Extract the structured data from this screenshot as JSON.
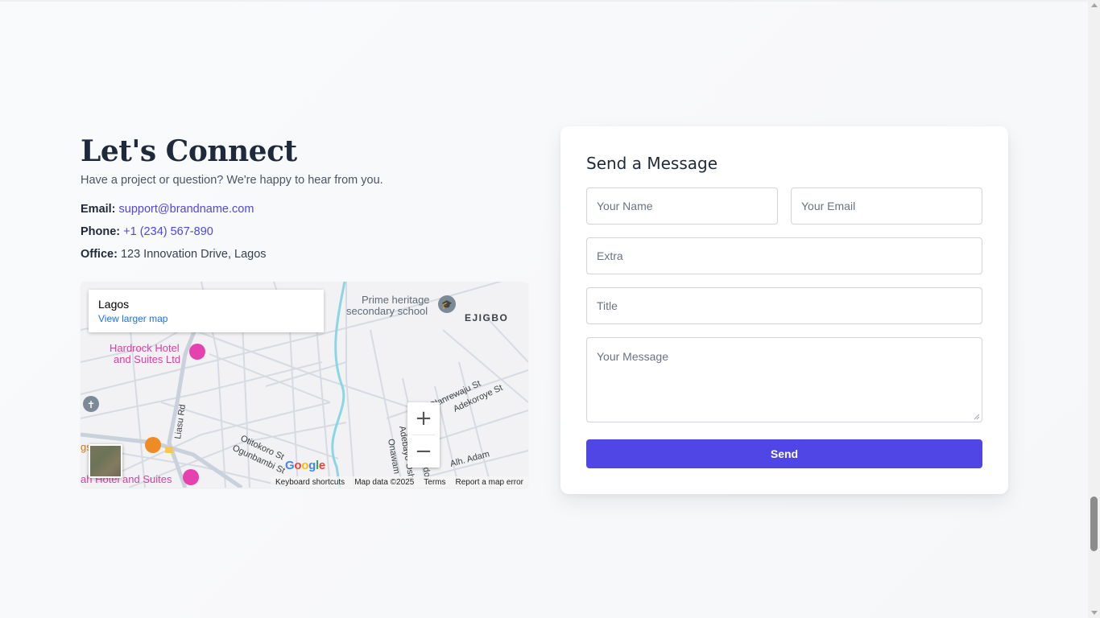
{
  "contact": {
    "title": "Let's Connect",
    "subtitle": "Have a project or question? We're happy to hear from you.",
    "email_label": "Email:",
    "email_value": "support@brandname.com",
    "phone_label": "Phone:",
    "phone_value": "+1 (234) 567-890",
    "office_label": "Office:",
    "office_value": "123 Innovation Drive, Lagos"
  },
  "map": {
    "place_name": "Lagos",
    "larger_map_link": "View larger map",
    "zoom_in": "+",
    "zoom_out": "−",
    "labels": {
      "school": "Prime heritage",
      "school2": "secondary school",
      "district": "EJIGBO",
      "hotel1a": "Hardrock Hotel",
      "hotel1b": "and Suites Ltd",
      "street1": "Liasu Rd",
      "street2": "Olanrewaju St",
      "street3": "Adekoroye St",
      "street4": "Otitokoro St",
      "street5": "Ogunbambi St",
      "street6": "Adebayo Osh",
      "street7": "Onawam",
      "street8": "Chris Ido",
      "street9": "Alh. Adam",
      "restaurant": "gs  more",
      "hotel2": "ah Hotel and Suites",
      "google": "Google"
    },
    "footer": {
      "shortcuts": "Keyboard shortcuts",
      "data": "Map data ©2025",
      "terms": "Terms",
      "report": "Report a map error"
    }
  },
  "form": {
    "title": "Send a Message",
    "name_placeholder": "Your Name",
    "email_placeholder": "Your Email",
    "extra_placeholder": "Extra",
    "title_placeholder": "Title",
    "message_placeholder": "Your Message",
    "send_label": "Send"
  },
  "colors": {
    "accent": "#4f46e5",
    "heading": "#1e293b",
    "link": "#1a73e8"
  }
}
